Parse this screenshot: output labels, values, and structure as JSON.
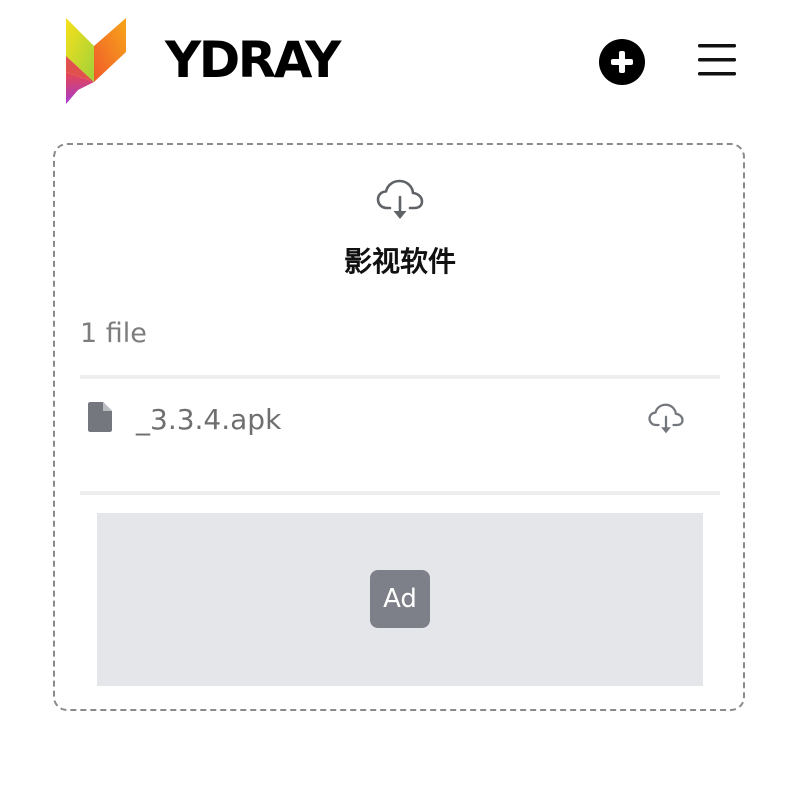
{
  "header": {
    "brand": "YDRAY",
    "add_icon": "plus-circle-icon",
    "menu_icon": "hamburger-menu-icon"
  },
  "transfer": {
    "title": "影视软件",
    "file_count": "1 file",
    "files": [
      {
        "name": "_3.3.4.apk",
        "icon": "file-icon",
        "action_icon": "cloud-download-icon"
      }
    ]
  },
  "ad": {
    "badge": "Ad"
  },
  "colors": {
    "logo_gradient": [
      "#f7c51a",
      "#f2822a",
      "#e8474b",
      "#b039c5"
    ],
    "text_muted": "#7d7d7d",
    "ad_bg": "#e5e6e9",
    "ad_badge": "#7d8089"
  }
}
